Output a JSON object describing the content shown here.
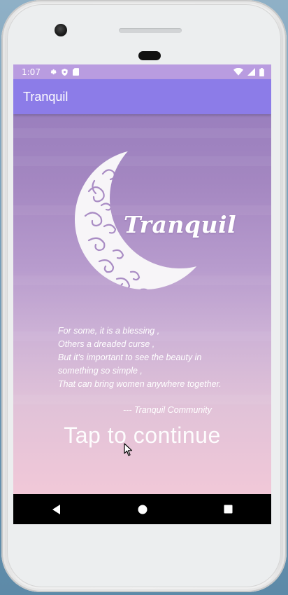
{
  "status": {
    "time": "1:07"
  },
  "appbar": {
    "title": "Tranquil"
  },
  "logo": {
    "text": "Tranquil"
  },
  "poem": {
    "lines": [
      "For some, it is a blessing ,",
      "Others a dreaded curse ,",
      "But it's important to see the beauty in",
      "something so simple ,",
      "That can bring women anywhere together."
    ],
    "attribution": "--- Tranquil Community"
  },
  "cta": {
    "label": "Tap to continue"
  },
  "colors": {
    "statusbar": "#b99ce0",
    "appbar": "#8c7ce8",
    "gradient_top": "#9a7fbe",
    "gradient_bottom": "#f1c8d8",
    "navbar": "#000000"
  },
  "icons": {
    "status_left": [
      "settings-icon",
      "shield-icon",
      "sd-card-icon"
    ],
    "status_right": [
      "wifi-icon",
      "signal-icon",
      "battery-icon"
    ],
    "nav": [
      "back-icon",
      "home-icon",
      "recents-icon"
    ]
  }
}
